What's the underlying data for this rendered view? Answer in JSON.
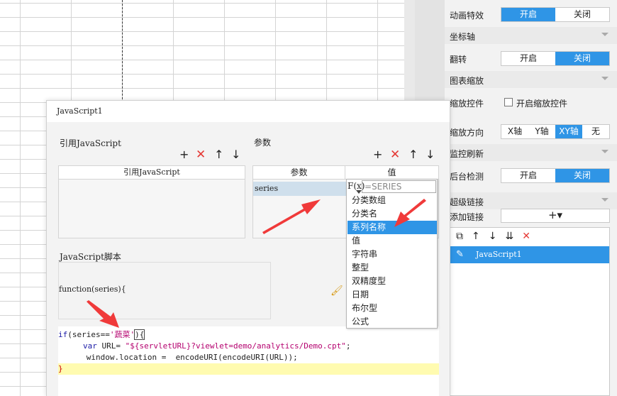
{
  "panel": {
    "rows": {
      "animation": {
        "label": "动画特效",
        "on": "开启",
        "off": "关闭"
      },
      "axis_section": "坐标轴",
      "flip": {
        "label": "翻转",
        "on": "开启",
        "off": "关闭"
      },
      "zoom_section": "图表缩放",
      "zoom_control": {
        "label": "缩放控件",
        "checkbox": "开启缩放控件"
      },
      "zoom_direction": {
        "label": "缩放方向",
        "options": [
          "X轴",
          "Y轴",
          "XY轴",
          "无"
        ]
      },
      "monitor_section": "监控刷新",
      "background_check": {
        "label": "后台检测",
        "on": "开启",
        "off": "关闭"
      },
      "hyperlink_section": "超级链接",
      "add_link": {
        "label": "添加链接",
        "button": "+▾"
      },
      "link_list": [
        "JavaScript1"
      ]
    }
  },
  "dialog": {
    "title": "JavaScript1",
    "ref_js_label": "引用JavaScript",
    "ref_js_col": "引用JavaScript",
    "params_label": "参数",
    "params_cols": [
      "参数",
      "值"
    ],
    "param_rows": [
      {
        "name": "series",
        "value": ""
      }
    ],
    "script_label": "JavaScript脚本",
    "function_sig": "function(series){",
    "code": {
      "line1_kw": "if",
      "line1_a": "(series==",
      "line1_str": "'蔬菜'",
      "line1_b": "){",
      "line2_kw": "var",
      "line2_a": " URL= ",
      "line2_str": "\"${servletURL}?viewlet=demo/analytics/Demo.cpt\"",
      "line2_b": ";",
      "line3": "      window.location =  encodeURI(encodeURI(URL));",
      "line4": "}"
    }
  },
  "dropdown": {
    "fx": "F(x)",
    "search_value": "=SERIES",
    "items": [
      "分类数组",
      "分类名",
      "系列名称",
      "值",
      "字符串",
      "整型",
      "双精度型",
      "日期",
      "布尔型",
      "公式"
    ],
    "selected": "系列名称"
  },
  "colors": {
    "accent": "#2f95e6",
    "danger": "#e53935",
    "highlight": "#fffbb0"
  }
}
